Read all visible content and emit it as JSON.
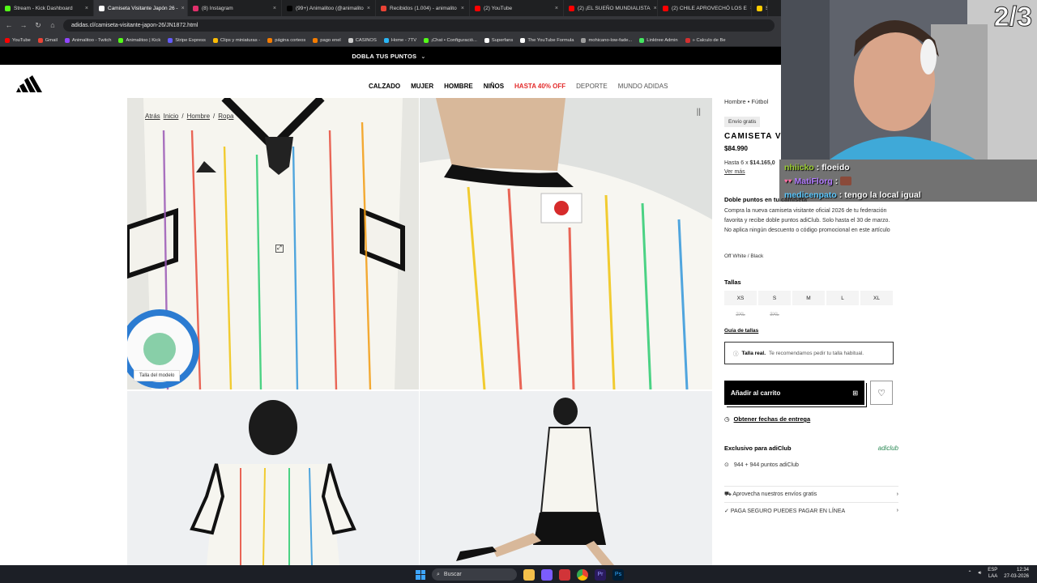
{
  "browser": {
    "tabs": [
      {
        "label": "Stream - Kick Dashboard",
        "color": "#53fc18",
        "active": false
      },
      {
        "label": "Camiseta Visitante Japón 26 -",
        "color": "#ffffff",
        "active": true
      },
      {
        "label": "(8) Instagram",
        "color": "#e1306c",
        "active": false
      },
      {
        "label": "(99+) Animalitoo (@animalito",
        "color": "#000000",
        "active": false
      },
      {
        "label": "Recibidos (1.004) - animalito",
        "color": "#ea4335",
        "active": false
      },
      {
        "label": "(2) YouTube",
        "color": "#ff0000",
        "active": false
      },
      {
        "label": "(2) ¡EL SUEÑO MUNDIALISTA",
        "color": "#ff0000",
        "active": false
      },
      {
        "label": "(2) CHILE APROVECHÓ LOS E",
        "color": "#ff0000",
        "active": false
      },
      {
        "label": "Si",
        "color": "#ffcc00",
        "active": false
      }
    ],
    "url": "adidas.cl/camiseta-visitante-japon-26/JN1872.html",
    "bookmarks": [
      {
        "label": "YouTube",
        "color": "#ff0000"
      },
      {
        "label": "Gmail",
        "color": "#ea4335"
      },
      {
        "label": "Animalitoo - Twitch",
        "color": "#9146ff"
      },
      {
        "label": "Animalitoo | Kick",
        "color": "#53fc18"
      },
      {
        "label": "Stripe Express",
        "color": "#635bff"
      },
      {
        "label": "Clips y miniaturas -",
        "color": "#fbbc05"
      },
      {
        "label": "página corteos",
        "color": "#f57c00"
      },
      {
        "label": "pago enel",
        "color": "#f57c00"
      },
      {
        "label": "CASINOS",
        "color": "#cccccc"
      },
      {
        "label": "Home - 7TV",
        "color": "#29b6f6"
      },
      {
        "label": "¡Chat • Configuració...",
        "color": "#53fc18"
      },
      {
        "label": "Superfans",
        "color": "#ffffff"
      },
      {
        "label": "The YouTube Formula",
        "color": "#ffffff"
      },
      {
        "label": "mohicano-low-fade...",
        "color": "#9e9e9e"
      },
      {
        "label": "Linktree Admin",
        "color": "#43e660"
      },
      {
        "label": "» Calculo de Be",
        "color": "#d32f2f"
      }
    ]
  },
  "site": {
    "promo": "DOBLA TUS PUNTOS",
    "nav": [
      "CALZADO",
      "MUJER",
      "HOMBRE",
      "NIÑOS",
      "HASTA 40% OFF",
      "DEPORTE",
      "MUNDO ADIDAS"
    ],
    "breadcrumb": {
      "back": "Atrás",
      "items": [
        "Inicio",
        "Hombre",
        "Ropa"
      ]
    },
    "model_tag": "Talla del modelo"
  },
  "product": {
    "category": "Hombre • Fútbol",
    "badge": "Envío gratis",
    "title": "CAMISETA VIS",
    "price": "$84.990",
    "installments_prefix": "Hasta 6 x",
    "installments_amount": "$14.165,0",
    "see_more": "Ver más",
    "promo_heading": "Doble puntos en tu camiseta",
    "promo_text": "Compra la nueva camiseta visitante oficial 2026 de tu federación favorita y recibe doble puntos adiClub. Solo hasta el 30 de marzo. No aplica ningún descuento o código promocional en este artículo",
    "color": "Off White / Black",
    "sizes_heading": "Tallas",
    "sizes": [
      {
        "label": "XS",
        "available": true
      },
      {
        "label": "S",
        "available": true
      },
      {
        "label": "M",
        "available": true
      },
      {
        "label": "L",
        "available": true
      },
      {
        "label": "XL",
        "available": true
      },
      {
        "label": "2XL",
        "available": false
      },
      {
        "label": "3XL",
        "available": false
      }
    ],
    "size_guide": "Guía de tallas",
    "fit_bold": "Talla real.",
    "fit_text": "Te recomendamos pedir tu talla habitual.",
    "add_to_cart": "Añadir al carrito",
    "delivery": "Obtener fechas de entrega",
    "exclusive": "Exclusivo para adiClub",
    "adiclub_logo": "adiclub",
    "points": "944 + 944 puntos adiClub",
    "shipping": "Aprovecha nuestros envíos gratis",
    "secure": "PAGA SEGURO PUEDES PAGAR EN LÍNEA"
  },
  "stream": {
    "counter": "2/3",
    "chat": [
      {
        "user": "nhiicko",
        "text": "floeido"
      },
      {
        "user": "MatiFlorg",
        "text": ""
      },
      {
        "user": "medicenpato",
        "text": "tengo la local igual"
      }
    ]
  },
  "taskbar": {
    "search": "Buscar",
    "lang": "ESP",
    "lang2": "LAA",
    "time": "12:34",
    "date": "27-03-2026"
  }
}
